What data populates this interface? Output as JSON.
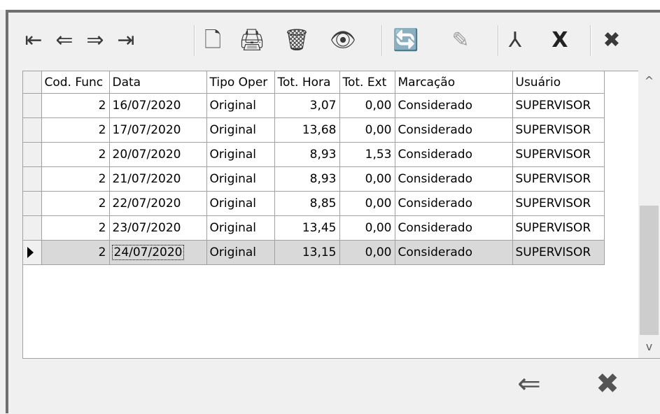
{
  "toolbar": {
    "first_icon": "⇤",
    "prev_icon": "⇐",
    "next_icon": "⇒",
    "last_icon": "⇥",
    "new_icon": "🗋",
    "print_icon": "🖨",
    "delete_icon": "🗑",
    "view_icon": "👁",
    "refresh_icon": "🔄",
    "edit_icon": "✎",
    "pdf_icon": "⅄",
    "excel_icon": "X",
    "close_icon": "✖"
  },
  "grid": {
    "columns": [
      "Cod. Func",
      "Data",
      "Tipo Oper",
      "Tot. Hora",
      "Tot. Ext",
      "Marcação",
      "Usuário"
    ],
    "rows": [
      {
        "cod": "2",
        "data": "16/07/2020",
        "tipo": "Original",
        "tot_hora": "3,07",
        "tot_ext": "0,00",
        "marcacao": "Considerado",
        "usuario": "SUPERVISOR"
      },
      {
        "cod": "2",
        "data": "17/07/2020",
        "tipo": "Original",
        "tot_hora": "13,68",
        "tot_ext": "0,00",
        "marcacao": "Considerado",
        "usuario": "SUPERVISOR"
      },
      {
        "cod": "2",
        "data": "20/07/2020",
        "tipo": "Original",
        "tot_hora": "8,93",
        "tot_ext": "1,53",
        "marcacao": "Considerado",
        "usuario": "SUPERVISOR"
      },
      {
        "cod": "2",
        "data": "21/07/2020",
        "tipo": "Original",
        "tot_hora": "8,93",
        "tot_ext": "0,00",
        "marcacao": "Considerado",
        "usuario": "SUPERVISOR"
      },
      {
        "cod": "2",
        "data": "22/07/2020",
        "tipo": "Original",
        "tot_hora": "8,85",
        "tot_ext": "0,00",
        "marcacao": "Considerado",
        "usuario": "SUPERVISOR"
      },
      {
        "cod": "2",
        "data": "23/07/2020",
        "tipo": "Original",
        "tot_hora": "13,45",
        "tot_ext": "0,00",
        "marcacao": "Considerado",
        "usuario": "SUPERVISOR"
      },
      {
        "cod": "2",
        "data": "24/07/2020",
        "tipo": "Original",
        "tot_hora": "13,15",
        "tot_ext": "0,00",
        "marcacao": "Considerado",
        "usuario": "SUPERVISOR"
      }
    ]
  },
  "scrollbar": {
    "up_icon": "^",
    "down_icon": "v"
  },
  "bottom": {
    "back_icon": "⇐",
    "close_icon": "✖"
  }
}
